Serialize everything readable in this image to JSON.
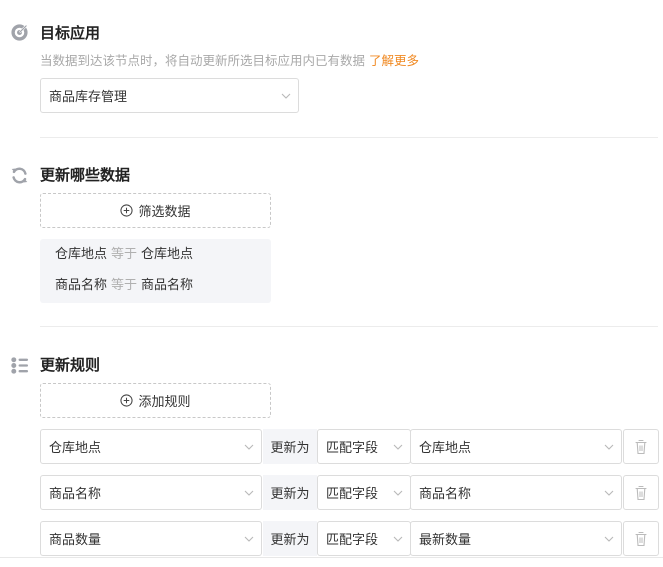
{
  "target_app": {
    "title": "目标应用",
    "description": "当数据到达该节点时，将自动更新所选目标应用内已有数据",
    "learn_more": "了解更多",
    "selected_app": "商品库存管理"
  },
  "update_data": {
    "title": "更新哪些数据",
    "filter_button": "筛选数据",
    "conditions": [
      {
        "field": "仓库地点",
        "operator": "等于",
        "value": "仓库地点"
      },
      {
        "field": "商品名称",
        "operator": "等于",
        "value": "商品名称"
      }
    ]
  },
  "update_rules": {
    "title": "更新规则",
    "add_button": "添加规则",
    "rules": [
      {
        "target_field": "仓库地点",
        "action": "更新为",
        "mode": "匹配字段",
        "source_field": "仓库地点"
      },
      {
        "target_field": "商品名称",
        "action": "更新为",
        "mode": "匹配字段",
        "source_field": "商品名称"
      },
      {
        "target_field": "商品数量",
        "action": "更新为",
        "mode": "匹配字段",
        "source_field": "最新数量"
      }
    ]
  },
  "colors": {
    "accent_link": "#f08a24",
    "icon_gray": "#a0a3aa",
    "muted_text": "#a8a8a8",
    "panel_bg": "#f4f5f8"
  }
}
